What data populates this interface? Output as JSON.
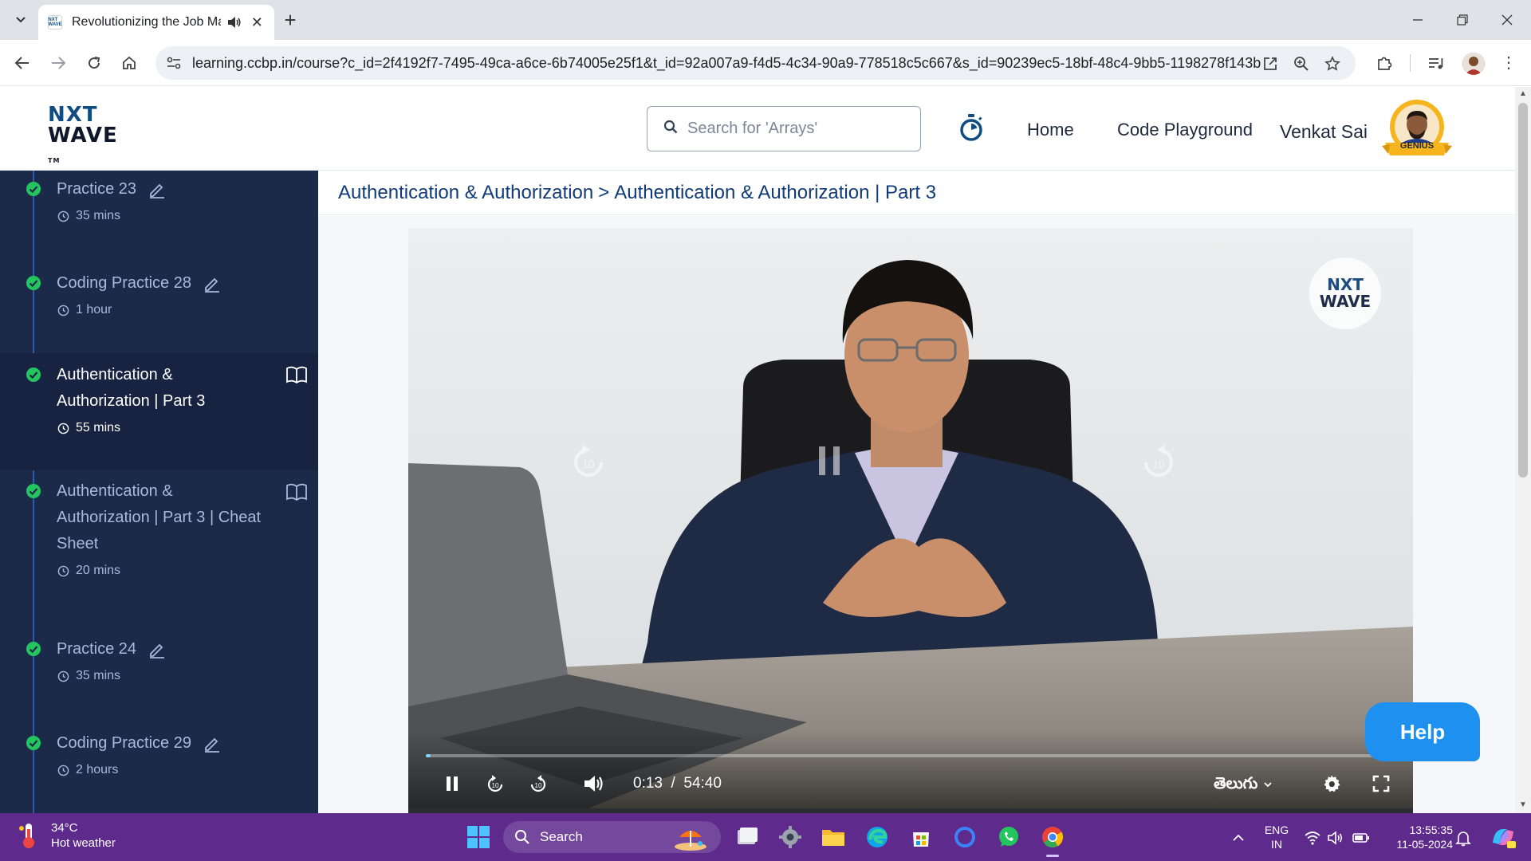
{
  "browser": {
    "tab": {
      "title": "Revolutionizing the Job Ma",
      "favicon_text": "NXT WAVE"
    },
    "url": "learning.ccbp.in/course?c_id=2f4192f7-7495-49ca-a6ce-6b74005e25f1&t_id=92a007a9-f4d5-4c34-90a9-778518c5c667&s_id=90239ec5-18bf-48c4-9bb5-1198278f143b"
  },
  "header": {
    "logo_line1": "NXT",
    "logo_line2": "WAVE",
    "logo_tm": "TM",
    "search_placeholder": "Search for 'Arrays'",
    "nav": {
      "home": "Home",
      "code_playground": "Code Playground"
    },
    "user_name": "Venkat Sai",
    "badge_label": "GENIUS"
  },
  "sidebar": {
    "items": [
      {
        "title_lines": [
          "Practice 23"
        ],
        "duration": "35 mins",
        "kind": "practice",
        "completed": true,
        "active": false
      },
      {
        "title_lines": [
          "Coding Practice 28"
        ],
        "duration": "1 hour",
        "kind": "practice",
        "completed": true,
        "active": false
      },
      {
        "title_lines": [
          "Authentication &",
          "Authorization | Part 3"
        ],
        "duration": "55 mins",
        "kind": "reading",
        "completed": true,
        "active": true
      },
      {
        "title_lines": [
          "Authentication &",
          "Authorization | Part 3 | Cheat",
          "Sheet"
        ],
        "duration": "20 mins",
        "kind": "reading",
        "completed": true,
        "active": false
      },
      {
        "title_lines": [
          "Practice 24"
        ],
        "duration": "35 mins",
        "kind": "practice",
        "completed": true,
        "active": false
      },
      {
        "title_lines": [
          "Coding Practice 29"
        ],
        "duration": "2 hours",
        "kind": "practice",
        "completed": true,
        "active": false
      }
    ]
  },
  "main": {
    "breadcrumb": {
      "parent": "Authentication & Authorization",
      "separator": ">",
      "current": "Authentication & Authorization | Part 3"
    },
    "video": {
      "watermark_line1": "NXT",
      "watermark_line2": "WAVE",
      "current_time": "0:13",
      "time_separator": "/",
      "duration": "54:40",
      "progress_fraction": 0.004,
      "language": "తెలుగు",
      "skip_seconds": "10"
    }
  },
  "help_button": "Help",
  "taskbar": {
    "weather_temp": "34°C",
    "weather_desc": "Hot weather",
    "search_label": "Search",
    "lang_line1": "ENG",
    "lang_line2": "IN",
    "time": "13:55:35",
    "date": "11-05-2024"
  },
  "colors": {
    "sidebar_bg": "#1c2a4a",
    "sidebar_active_bg": "#172340",
    "check_green": "#22c55e",
    "breadcrumb_text": "#103a78",
    "help_button": "#1e90f0",
    "taskbar": "#5e2a8c"
  }
}
